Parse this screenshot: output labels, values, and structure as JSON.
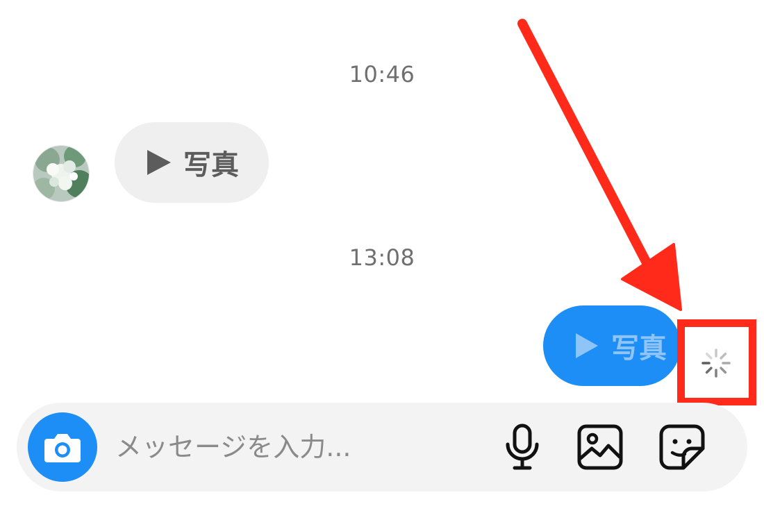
{
  "chat": {
    "timestamps": [
      "10:46",
      "13:08"
    ],
    "incoming_message": {
      "type": "photo",
      "label": "写真"
    },
    "outgoing_message": {
      "type": "photo",
      "label": "写真",
      "status": "sending"
    }
  },
  "composer": {
    "placeholder": "メッセージを入力...",
    "value": "",
    "icons": [
      "camera-icon",
      "microphone-icon",
      "image-gallery-icon",
      "sticker-icon"
    ]
  },
  "colors": {
    "accent_blue": "#1c8ef6",
    "incoming_bubble": "#efefef",
    "annotation_red": "#ff2a1a"
  }
}
